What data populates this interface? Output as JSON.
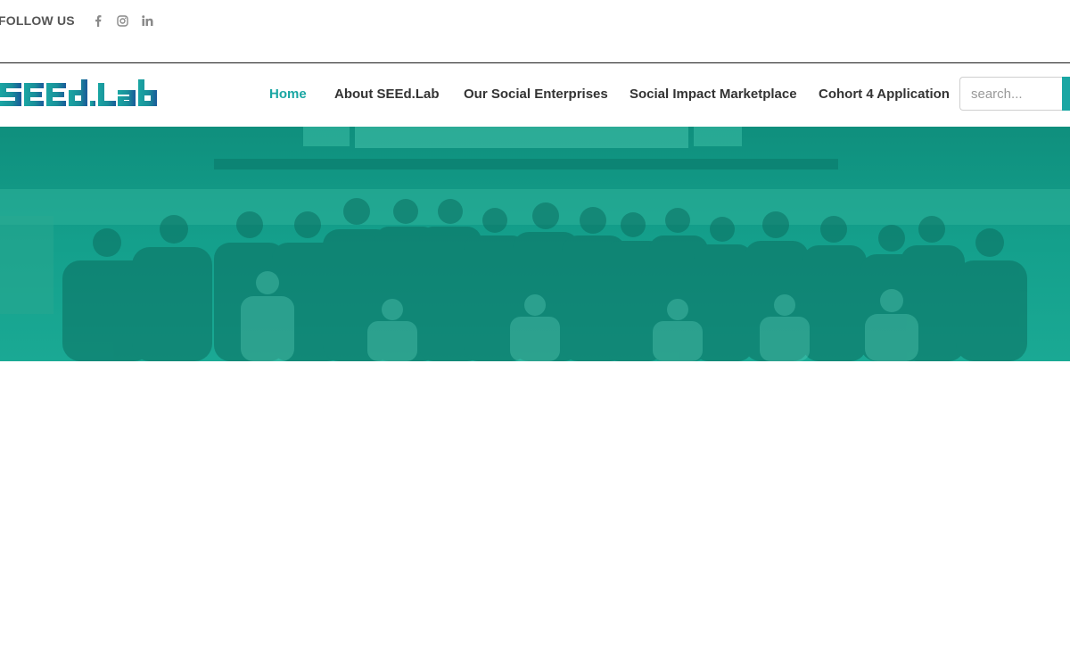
{
  "header": {
    "follow_label": "FOLLOW US",
    "social": [
      {
        "icon": "facebook-icon"
      },
      {
        "icon": "instagram-icon"
      },
      {
        "icon": "linkedin-icon"
      }
    ]
  },
  "brand": {
    "logo_text": "SEEd.Lab",
    "colors": {
      "primary": "#1aa6a3",
      "secondary": "#1a5a9a"
    }
  },
  "nav": {
    "items": [
      {
        "label": "Home",
        "active": true
      },
      {
        "label": "About SEEd.Lab"
      },
      {
        "label": "Our Social Enterprises"
      },
      {
        "label": "Social Impact Marketplace"
      },
      {
        "label": "Cohort 4 Application"
      }
    ],
    "search_placeholder": "search..."
  },
  "hero": {
    "overlay_color": "#17a08f"
  }
}
